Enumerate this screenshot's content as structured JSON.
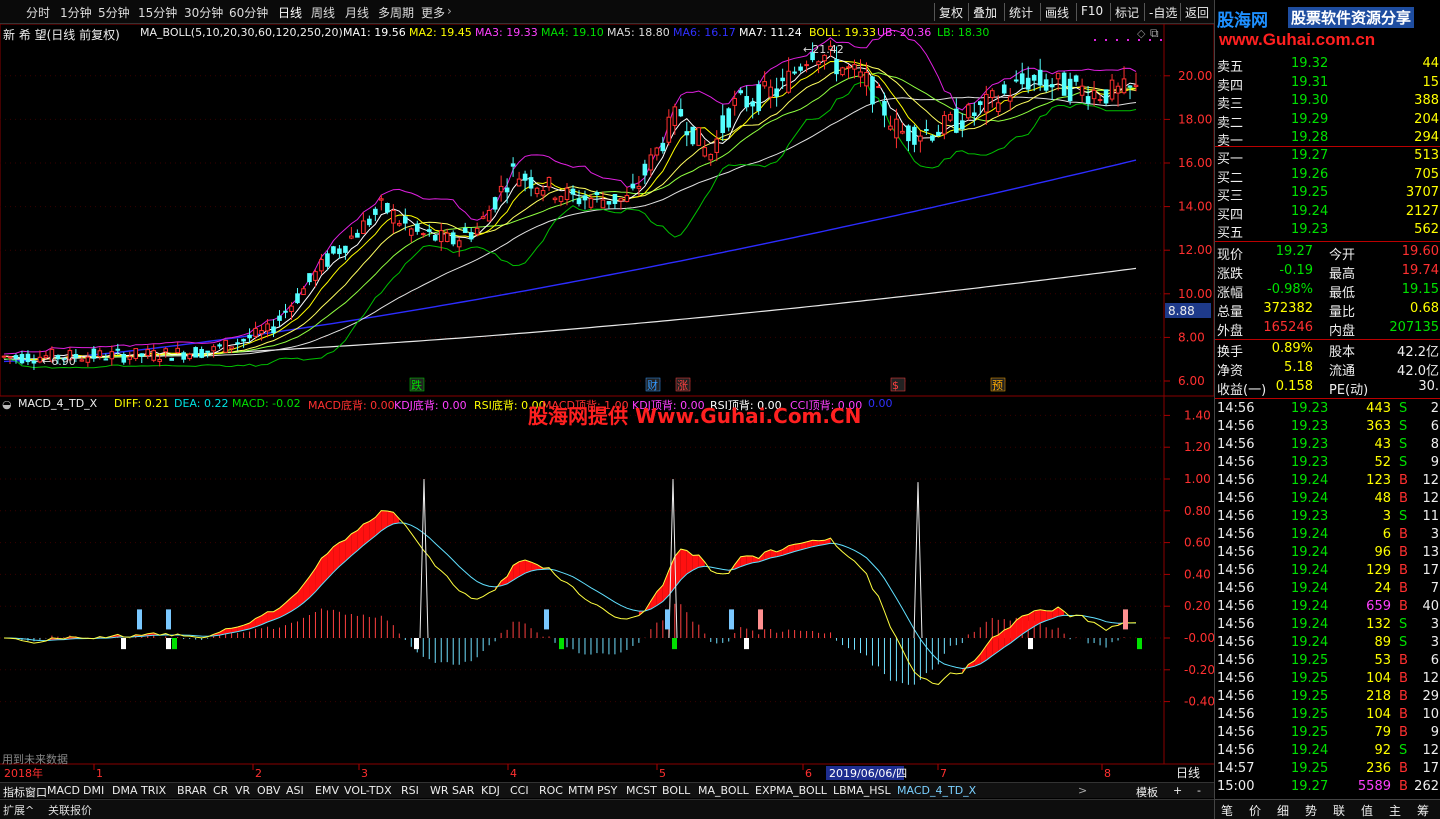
{
  "toolbar": {
    "periods": [
      "分时",
      "1分钟",
      "5分钟",
      "15分钟",
      "30分钟",
      "60分钟",
      "日线",
      "周线",
      "月线",
      "多周期",
      "更多"
    ],
    "active_period": "日线",
    "right_buttons": [
      "复权",
      "叠加",
      "统计",
      "画线",
      "F10",
      "标记",
      "-自选",
      "返回"
    ]
  },
  "main_chart": {
    "header_name": "新 希 望(日线 前复权)",
    "indicator_name": "MA_BOLL(5,10,20,30,60,120,250,20)",
    "ma_values": [
      {
        "label": "MA1: 19.56",
        "color": "#ffffff"
      },
      {
        "label": "MA2: 19.45",
        "color": "#ffff00"
      },
      {
        "label": "MA3: 19.33",
        "color": "#ff40ff"
      },
      {
        "label": "MA4: 19.10",
        "color": "#00e000"
      },
      {
        "label": "MA5: 18.80",
        "color": "#dddddd"
      },
      {
        "label": "MA6: 16.17",
        "color": "#3030ff"
      },
      {
        "label": "MA7: 11.24",
        "color": "#ffffff"
      },
      {
        "label": "BOLL: 19.33",
        "color": "#ffff00"
      },
      {
        "label": "UB: 20.36",
        "color": "#ff40ff"
      },
      {
        "label": "LB: 18.30",
        "color": "#00e000"
      }
    ],
    "y_ticks": [
      "20.00",
      "18.00",
      "16.00",
      "14.00",
      "12.00",
      "10.00",
      "8.00",
      "6.00"
    ],
    "current_price_tag": "8.88",
    "high_label": "21.42",
    "low_label": "6.90",
    "event_marks": [
      {
        "text": "跌",
        "color": "#00e000"
      },
      {
        "text": "财",
        "color": "#3399ff"
      },
      {
        "text": "涨",
        "color": "#ff4040"
      },
      {
        "text": "$",
        "color": "#ff4040"
      },
      {
        "text": "预",
        "color": "#ffaa00"
      }
    ]
  },
  "macd_panel": {
    "header": "MACD_4_TD_X",
    "values": [
      {
        "label": "DIFF: 0.21",
        "color": "#ffff00"
      },
      {
        "label": "DEA: 0.22",
        "color": "#00e0e0"
      },
      {
        "label": "MACD: -0.02",
        "color": "#00e000"
      },
      {
        "label": "MACD底背: 0.00",
        "color": "#ff3030"
      },
      {
        "label": "KDJ底背: 0.00",
        "color": "#ff40ff"
      },
      {
        "label": "RSI底背: 0.00",
        "color": "#ffff00"
      },
      {
        "label": "MACD顶背: 1.00",
        "color": "#ff3030"
      },
      {
        "label": "KDJ顶背: 0.00",
        "color": "#ff40ff"
      },
      {
        "label": "RSI顶背: 0.00",
        "color": "#ffffff"
      },
      {
        "label": "CCI顶背: 0.00",
        "color": "#ff40ff"
      },
      {
        "label": "0.00",
        "color": "#3030ff"
      }
    ],
    "y_ticks": [
      "1.40",
      "1.20",
      "1.00",
      "0.80",
      "0.60",
      "0.40",
      "0.20",
      "-0.00",
      "-0.20",
      "-0.40"
    ],
    "future_data_note": "用到未来数据"
  },
  "watermark": "股海网提供 Www.Guhai.Com.CN",
  "time_axis": {
    "year_label": "2018年",
    "months": [
      "1",
      "2",
      "3",
      "4",
      "5",
      "6",
      "7",
      "8"
    ],
    "cursor_date": "2019/06/06/四",
    "period_label": "日线"
  },
  "indicator_tabs": [
    "指标",
    "窗口",
    "MACD",
    "DMI",
    "DMA",
    "TRIX",
    "BRAR",
    "CR",
    "VR",
    "OBV",
    "ASI",
    "EMV",
    "VOL-TDX",
    "RSI",
    "WR",
    "SAR",
    "KDJ",
    "CCI",
    "ROC",
    "MTM",
    "PSY",
    "MCST",
    "BOLL",
    "MA_BOLL",
    "EXPMA_BOLL",
    "LBMA_HSL",
    "MACD_4_TD_X"
  ],
  "tabs_right": [
    "模板",
    "+",
    "-"
  ],
  "bottom_bar": [
    "扩展^",
    "关联报价"
  ],
  "logo": {
    "site": "股海网",
    "slogan": "股票软件资源分享",
    "url": "www.Guhai.com.cn"
  },
  "order_book": {
    "asks": [
      {
        "label": "卖五",
        "price": "19.32",
        "vol": "44"
      },
      {
        "label": "卖四",
        "price": "19.31",
        "vol": "15"
      },
      {
        "label": "卖三",
        "price": "19.30",
        "vol": "388"
      },
      {
        "label": "卖二",
        "price": "19.29",
        "vol": "204"
      },
      {
        "label": "卖一",
        "price": "19.28",
        "vol": "294"
      }
    ],
    "bids": [
      {
        "label": "买一",
        "price": "19.27",
        "vol": "513"
      },
      {
        "label": "买二",
        "price": "19.26",
        "vol": "705"
      },
      {
        "label": "买三",
        "price": "19.25",
        "vol": "3707"
      },
      {
        "label": "买四",
        "price": "19.24",
        "vol": "2127"
      },
      {
        "label": "买五",
        "price": "19.23",
        "vol": "562"
      }
    ]
  },
  "quote": [
    {
      "l1": "现价",
      "v1": "19.27",
      "c1": "green",
      "l2": "今开",
      "v2": "19.60",
      "c2": "red"
    },
    {
      "l1": "涨跌",
      "v1": "-0.19",
      "c1": "green",
      "l2": "最高",
      "v2": "19.74",
      "c2": "red"
    },
    {
      "l1": "涨幅",
      "v1": "-0.98%",
      "c1": "green",
      "l2": "最低",
      "v2": "19.15",
      "c2": "green"
    },
    {
      "l1": "总量",
      "v1": "372382",
      "c1": "yellow",
      "l2": "量比",
      "v2": "0.68",
      "c2": "yellow"
    },
    {
      "l1": "外盘",
      "v1": "165246",
      "c1": "red",
      "l2": "内盘",
      "v2": "207135",
      "c2": "green"
    }
  ],
  "stats": [
    {
      "l1": "换手",
      "v1": "0.89%",
      "l2": "股本",
      "v2": "42.2亿"
    },
    {
      "l1": "净资",
      "v1": "5.18",
      "l2": "流通",
      "v2": "42.0亿"
    },
    {
      "l1": "收益(一)",
      "v1": "0.158",
      "l2": "PE(动)",
      "v2": "30."
    }
  ],
  "ticks": [
    {
      "t": "14:56",
      "p": "19.23",
      "v": "443",
      "d": "S",
      "n": "2"
    },
    {
      "t": "14:56",
      "p": "19.23",
      "v": "363",
      "d": "S",
      "n": "6"
    },
    {
      "t": "14:56",
      "p": "19.23",
      "v": "43",
      "d": "S",
      "n": "8"
    },
    {
      "t": "14:56",
      "p": "19.23",
      "v": "52",
      "d": "S",
      "n": "9"
    },
    {
      "t": "14:56",
      "p": "19.24",
      "v": "123",
      "d": "B",
      "n": "12"
    },
    {
      "t": "14:56",
      "p": "19.24",
      "v": "48",
      "d": "B",
      "n": "12"
    },
    {
      "t": "14:56",
      "p": "19.23",
      "v": "3",
      "d": "S",
      "n": "11"
    },
    {
      "t": "14:56",
      "p": "19.24",
      "v": "6",
      "d": "B",
      "n": "3"
    },
    {
      "t": "14:56",
      "p": "19.24",
      "v": "96",
      "d": "B",
      "n": "13"
    },
    {
      "t": "14:56",
      "p": "19.24",
      "v": "129",
      "d": "B",
      "n": "17"
    },
    {
      "t": "14:56",
      "p": "19.24",
      "v": "24",
      "d": "B",
      "n": "7"
    },
    {
      "t": "14:56",
      "p": "19.24",
      "v": "659",
      "d": "B",
      "n": "40"
    },
    {
      "t": "14:56",
      "p": "19.24",
      "v": "132",
      "d": "S",
      "n": "3"
    },
    {
      "t": "14:56",
      "p": "19.24",
      "v": "89",
      "d": "S",
      "n": "3"
    },
    {
      "t": "14:56",
      "p": "19.25",
      "v": "53",
      "d": "B",
      "n": "6"
    },
    {
      "t": "14:56",
      "p": "19.25",
      "v": "104",
      "d": "B",
      "n": "12"
    },
    {
      "t": "14:56",
      "p": "19.25",
      "v": "218",
      "d": "B",
      "n": "29"
    },
    {
      "t": "14:56",
      "p": "19.25",
      "v": "104",
      "d": "B",
      "n": "10"
    },
    {
      "t": "14:56",
      "p": "19.25",
      "v": "79",
      "d": "B",
      "n": "9"
    },
    {
      "t": "14:56",
      "p": "19.24",
      "v": "92",
      "d": "S",
      "n": "12"
    },
    {
      "t": "14:57",
      "p": "19.25",
      "v": "236",
      "d": "B",
      "n": "17"
    },
    {
      "t": "15:00",
      "p": "19.27",
      "v": "5589",
      "d": "B",
      "n": "262"
    }
  ],
  "floating_toolbar": [
    "中",
    "●",
    "●",
    "⋮⋮"
  ],
  "right_footer": [
    "笔",
    "价",
    "细",
    "势",
    "联",
    "值",
    "主",
    "筹"
  ]
}
